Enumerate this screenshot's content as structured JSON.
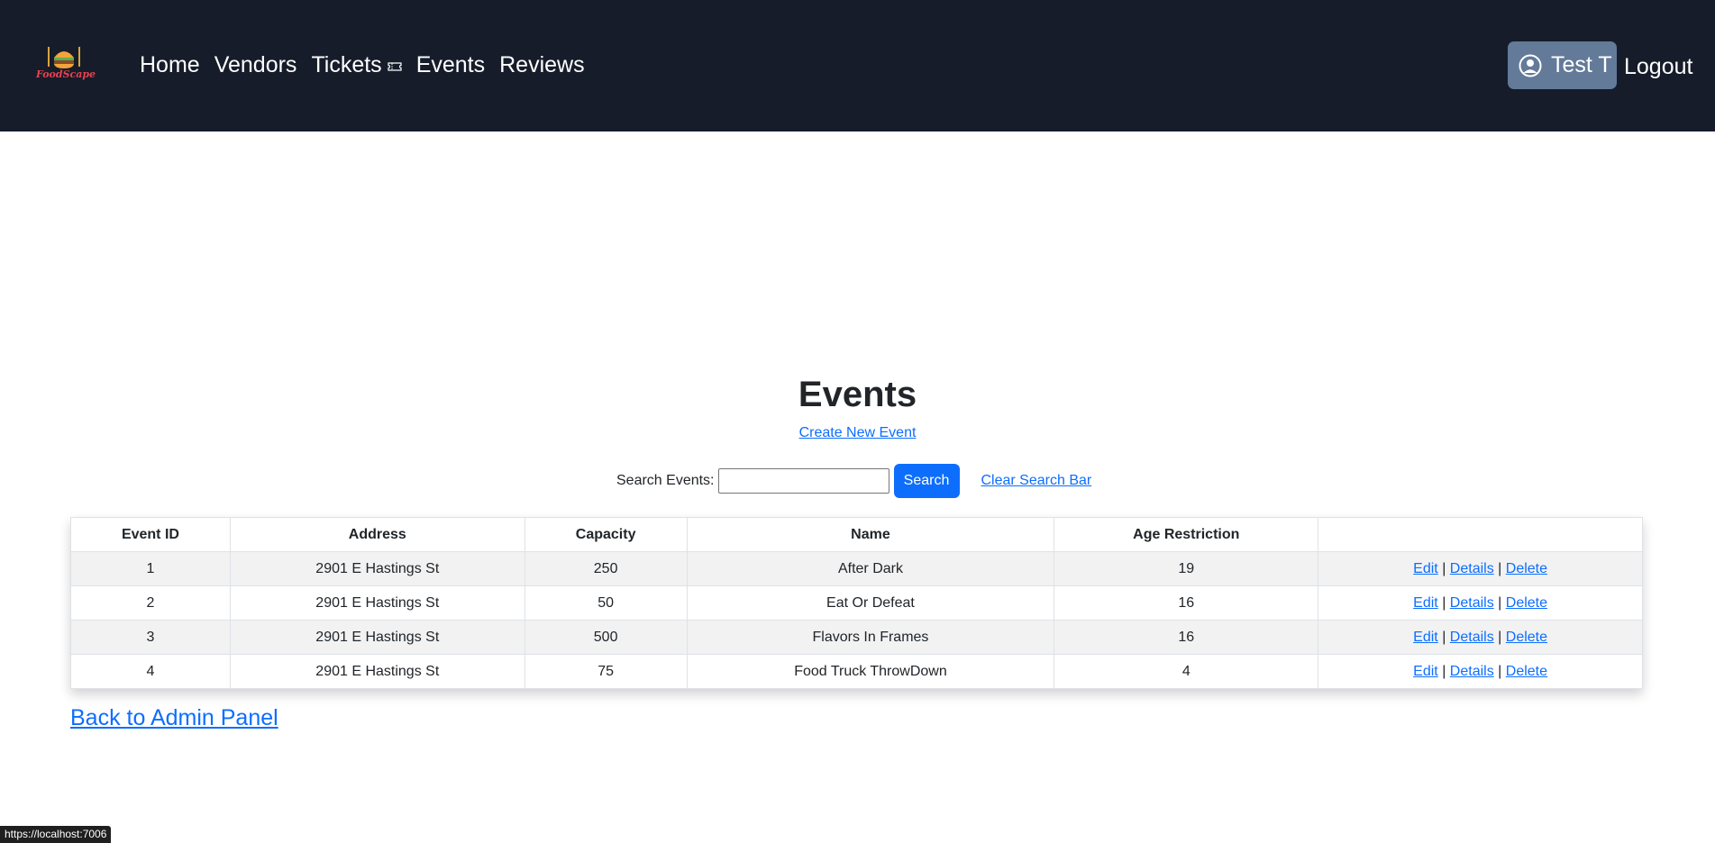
{
  "brand": {
    "logo_text": "FoodScape"
  },
  "nav": {
    "items": [
      {
        "label": "Home"
      },
      {
        "label": "Vendors"
      },
      {
        "label": "Tickets"
      },
      {
        "label": "Events"
      },
      {
        "label": "Reviews"
      }
    ],
    "user_label": "Test T",
    "logout_label": "Logout",
    "icons": {
      "tickets": "ticket-icon",
      "user": "user-circle-icon"
    }
  },
  "main": {
    "title": "Events",
    "create_link": "Create New Event",
    "search": {
      "label": "Search Events:",
      "value": "",
      "placeholder": "",
      "button_label": "Search",
      "clear_label": "Clear Search Bar"
    },
    "table": {
      "headers": [
        "Event ID",
        "Address",
        "Capacity",
        "Name",
        "Age Restriction",
        ""
      ],
      "rows": [
        {
          "id": "1",
          "address": "2901 E Hastings St",
          "capacity": "250",
          "name": "After Dark",
          "age": "19"
        },
        {
          "id": "2",
          "address": "2901 E Hastings St",
          "capacity": "50",
          "name": "Eat Or Defeat",
          "age": "16"
        },
        {
          "id": "3",
          "address": "2901 E Hastings St",
          "capacity": "500",
          "name": "Flavors In Frames",
          "age": "16"
        },
        {
          "id": "4",
          "address": "2901 E Hastings St",
          "capacity": "75",
          "name": "Food Truck ThrowDown",
          "age": "4"
        }
      ],
      "actions": {
        "edit": "Edit",
        "details": "Details",
        "delete": "Delete",
        "separator": "|"
      }
    },
    "back_link": "Back to Admin Panel"
  },
  "status_bar": {
    "url": "https://localhost:7006"
  },
  "colors": {
    "navbar_bg": "#161c2a",
    "user_button_bg": "#637a99",
    "primary": "#0d6efd",
    "row_stripe": "#f2f2f2",
    "logo_text": "#e8414f"
  }
}
